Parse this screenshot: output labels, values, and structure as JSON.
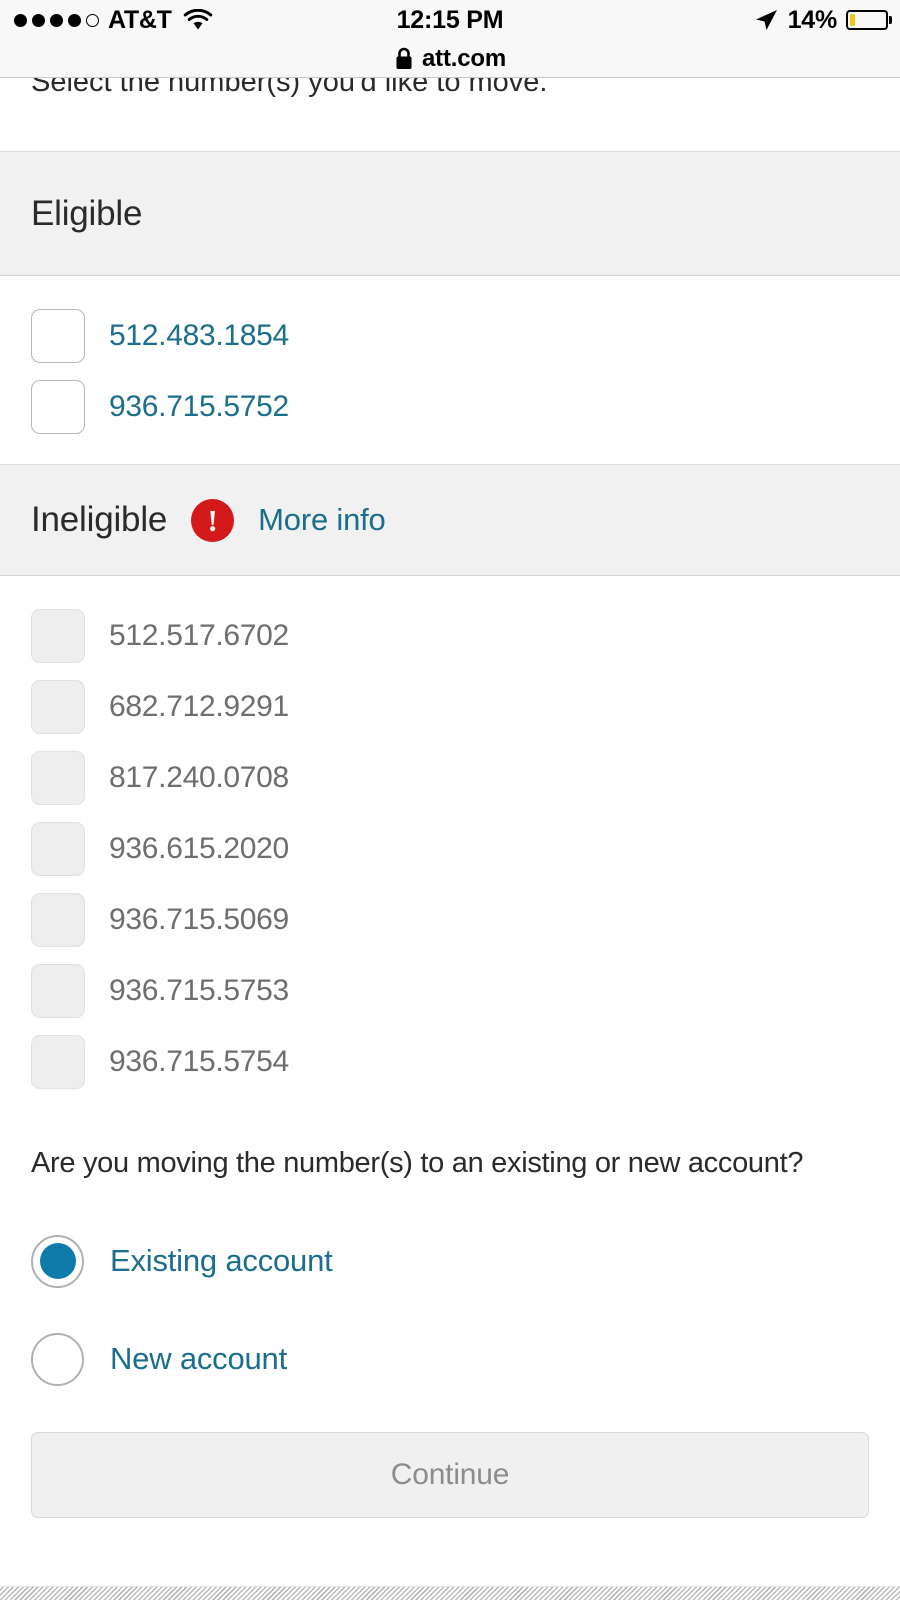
{
  "status_bar": {
    "carrier": "AT&T",
    "signal_bars_filled": 4,
    "signal_bars_total": 5,
    "wifi_icon": "wifi-icon",
    "time": "12:15 PM",
    "location_icon": "location-arrow-icon",
    "battery_percent": "14%",
    "battery_level": 14,
    "battery_color": "#f5c518"
  },
  "browser": {
    "lock_icon": "lock-icon",
    "url": "att.com"
  },
  "page": {
    "intro_text": "Select the number(s) you'd like to move.",
    "eligible": {
      "title": "Eligible",
      "numbers": [
        {
          "number": "512.483.1854",
          "checked": false,
          "disabled": false
        },
        {
          "number": "936.715.5752",
          "checked": false,
          "disabled": false
        }
      ]
    },
    "ineligible": {
      "title": "Ineligible",
      "alert_icon": "alert-exclamation-icon",
      "alert_color": "#d4191b",
      "more_info_label": "More info",
      "numbers": [
        {
          "number": "512.517.6702",
          "checked": false,
          "disabled": true
        },
        {
          "number": "682.712.9291",
          "checked": false,
          "disabled": true
        },
        {
          "number": "817.240.0708",
          "checked": false,
          "disabled": true
        },
        {
          "number": "936.615.2020",
          "checked": false,
          "disabled": true
        },
        {
          "number": "936.715.5069",
          "checked": false,
          "disabled": true
        },
        {
          "number": "936.715.5753",
          "checked": false,
          "disabled": true
        },
        {
          "number": "936.715.5754",
          "checked": false,
          "disabled": true
        }
      ]
    },
    "account_question": {
      "label": "Are you moving the number(s) to an existing or new account?",
      "options": [
        {
          "label": "Existing account",
          "selected": true
        },
        {
          "label": "New account",
          "selected": false
        }
      ]
    },
    "continue_button": {
      "label": "Continue",
      "disabled": true
    }
  },
  "colors": {
    "link": "#1b6e8c",
    "radio_selected": "#0f7bab",
    "band_background": "#f1f1f1",
    "alert_red": "#d4191b"
  }
}
